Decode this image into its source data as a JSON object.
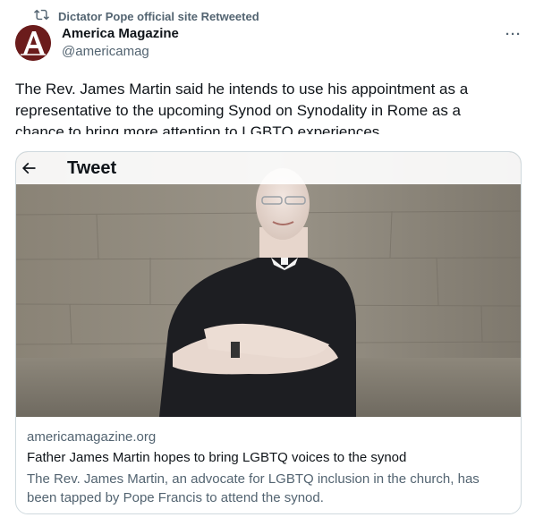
{
  "retweet": {
    "label": "Dictator Pope official site Retweeted",
    "icon": "retweet-icon"
  },
  "author": {
    "name": "America Magazine",
    "handle": "@americamag",
    "avatar_icon": "america-magazine-logo",
    "avatar_color": "#6b1c1c"
  },
  "more_icon": "more-options-icon",
  "tweet": {
    "text": "The Rev. James Martin said he intends to use his appointment as a representative to the upcoming Synod on Synodality in Rome as a chance to bring more attention to LGBTQ experiences."
  },
  "overlay": {
    "back_icon": "back-arrow-icon",
    "title": "Tweet"
  },
  "card": {
    "domain": "americamagazine.org",
    "headline": "Father James Martin hopes to bring LGBTQ voices to the synod",
    "description": "The Rev. James Martin, an advocate for LGBTQ inclusion in the church, has been tapped by Pope Francis to attend the synod."
  },
  "colors": {
    "secondary_text": "#536471",
    "primary_text": "#0f1419",
    "border": "#cfd9de"
  }
}
